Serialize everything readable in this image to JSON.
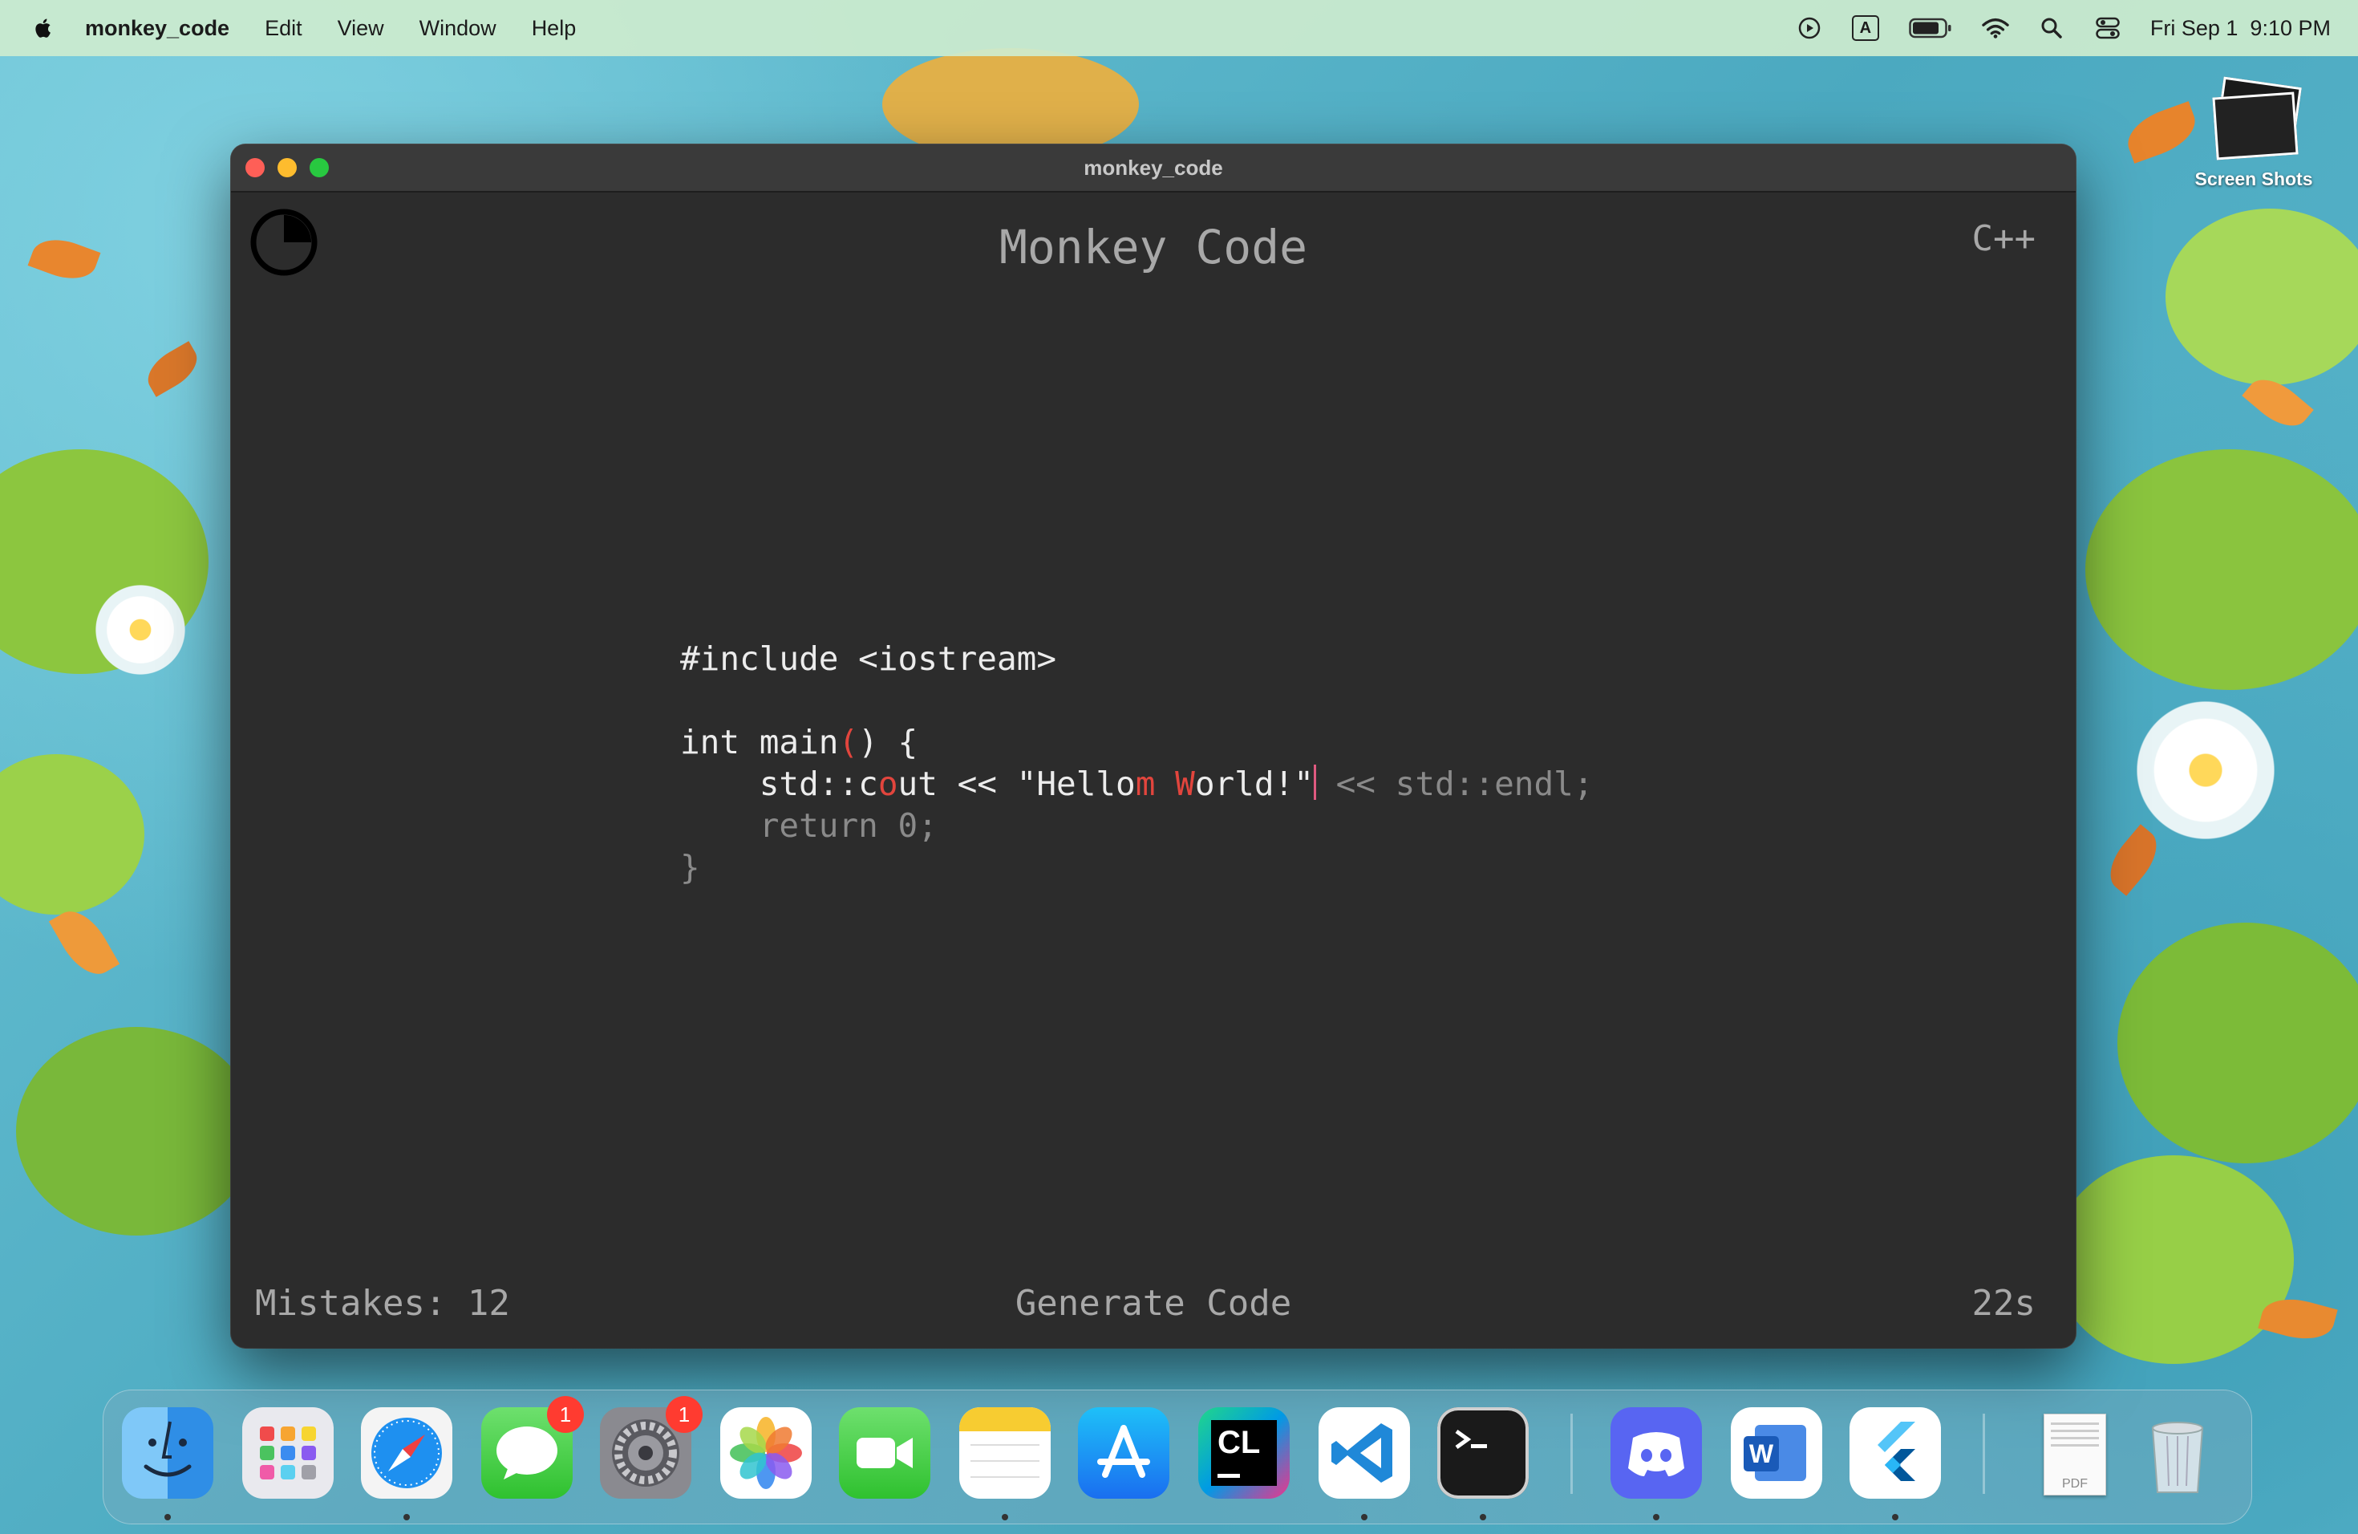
{
  "menubar": {
    "app_name": "monkey_code",
    "items": [
      "Edit",
      "View",
      "Window",
      "Help"
    ],
    "clock": "Fri Sep 1  9:10 PM",
    "keyboard_input": "A"
  },
  "desktop": {
    "folder_label": "Screen Shots"
  },
  "window": {
    "title": "monkey_code",
    "app_title": "Monkey Code",
    "language": "C++",
    "code": {
      "line1": "#include <iostream>",
      "line3_typed": "int main",
      "line3_err": "(",
      "line3_typed2": ") {",
      "line4_typed1": "    std::c",
      "line4_err1": "o",
      "line4_typed2": "ut << \"Hello",
      "line4_err2": "m",
      "line4_typed3": " ",
      "line4_err3": "W",
      "line4_typed4": "orld!\"",
      "line4_pending": " << std::endl;",
      "line5_pending": "    return 0;",
      "line6_pending": "}"
    },
    "footer": {
      "mistakes": "Mistakes: 12",
      "generate": "Generate Code",
      "time": "22s"
    }
  },
  "dock": {
    "apps": [
      "finder",
      "launchpad",
      "safari",
      "messages",
      "system-settings",
      "photos",
      "facetime",
      "notes",
      "app-store",
      "clion",
      "vscode",
      "terminal",
      "discord",
      "word",
      "flutter",
      "pdf-document",
      "trash"
    ],
    "messages_badge": "1",
    "settings_badge": "1",
    "clion_label": "CL",
    "word_label": "W",
    "pdf_label": "PDF"
  },
  "colors": {
    "error": "#e2453d",
    "caret": "#e05a80",
    "window_bg": "#2c2c2c"
  }
}
